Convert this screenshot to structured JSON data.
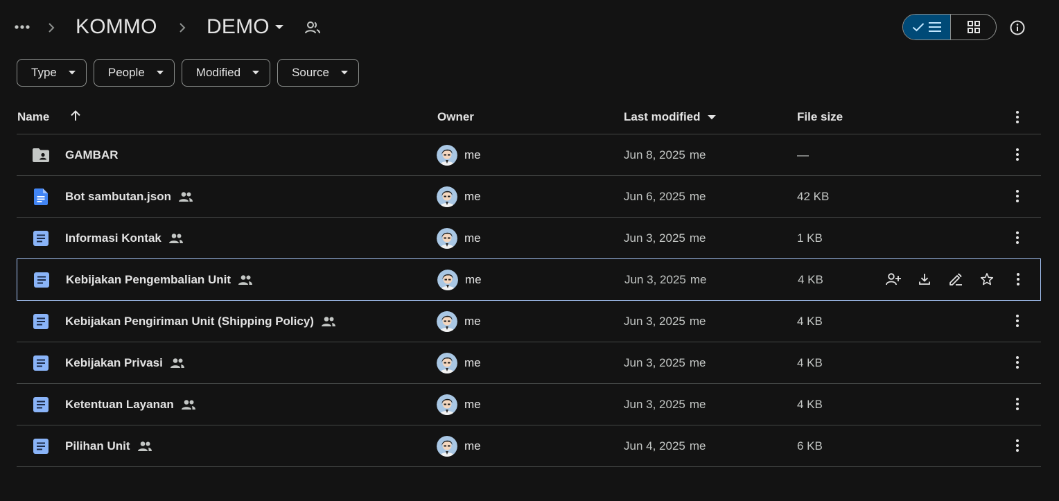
{
  "breadcrumb": {
    "more_icon": "more-horiz-icon",
    "items": [
      "KOMMO",
      "DEMO"
    ],
    "dropdown_icon": "arrow-drop-down-icon",
    "shared_icon": "shared-folder-icon"
  },
  "view_toggle": {
    "active": "list",
    "list_icon": "check-list-icon",
    "grid_icon": "grid-view-icon"
  },
  "info_icon": "info-icon",
  "filters": [
    "Type",
    "People",
    "Modified",
    "Source"
  ],
  "table": {
    "columns": {
      "name": "Name",
      "owner": "Owner",
      "last_modified": "Last modified",
      "file_size": "File size"
    },
    "sort_icon": "arrow-up-icon",
    "rows": [
      {
        "name": "GAMBAR",
        "type": "shared-folder",
        "shared": false,
        "owner": "me",
        "modified": "Jun 8, 2025",
        "modified_by": "me",
        "size": "—"
      },
      {
        "name": "Bot sambutan.json",
        "type": "file",
        "shared": true,
        "owner": "me",
        "modified": "Jun 6, 2025",
        "modified_by": "me",
        "size": "42 KB"
      },
      {
        "name": "Informasi Kontak",
        "type": "doc",
        "shared": true,
        "owner": "me",
        "modified": "Jun 3, 2025",
        "modified_by": "me",
        "size": "1 KB"
      },
      {
        "name": "Kebijakan Pengembalian Unit",
        "type": "doc",
        "shared": true,
        "owner": "me",
        "modified": "Jun 3, 2025",
        "modified_by": "me",
        "size": "4 KB",
        "selected": true
      },
      {
        "name": "Kebijakan Pengiriman Unit (Shipping Policy)",
        "type": "doc",
        "shared": true,
        "owner": "me",
        "modified": "Jun 3, 2025",
        "modified_by": "me",
        "size": "4 KB"
      },
      {
        "name": "Kebijakan Privasi",
        "type": "doc",
        "shared": true,
        "owner": "me",
        "modified": "Jun 3, 2025",
        "modified_by": "me",
        "size": "4 KB"
      },
      {
        "name": "Ketentuan Layanan",
        "type": "doc",
        "shared": true,
        "owner": "me",
        "modified": "Jun 3, 2025",
        "modified_by": "me",
        "size": "4 KB"
      },
      {
        "name": "Pilihan Unit",
        "type": "doc",
        "shared": true,
        "owner": "me",
        "modified": "Jun 4, 2025",
        "modified_by": "me",
        "size": "6 KB"
      }
    ],
    "row_actions": [
      "share-icon",
      "download-icon",
      "rename-icon",
      "star-icon"
    ]
  },
  "colors": {
    "background": "#131313",
    "text": "#e3e3e3",
    "toggle_active": "#004a77",
    "selected_border": "#a8c7fa",
    "doc_icon": "#8ab4f8",
    "file_icon": "#4285f4"
  }
}
